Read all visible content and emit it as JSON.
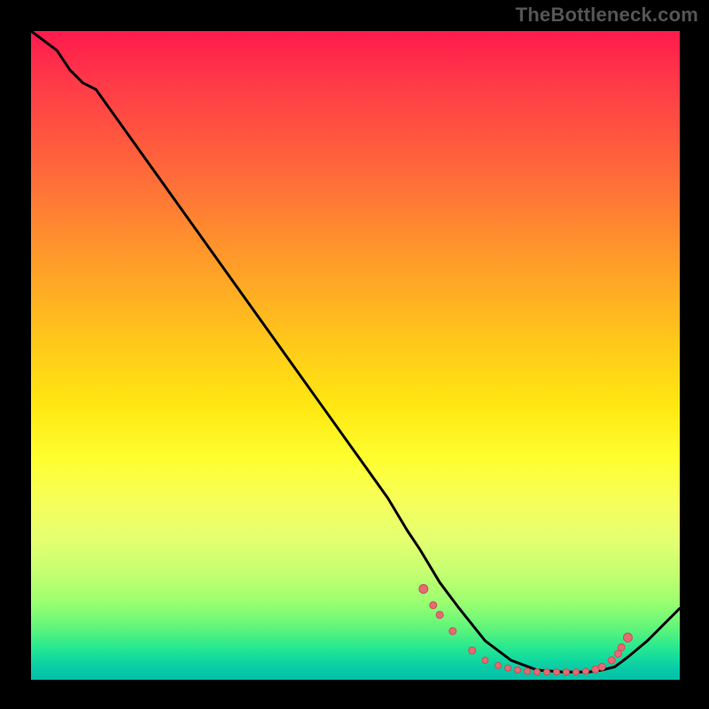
{
  "watermark": "TheBottleneck.com",
  "chart_data": {
    "type": "line",
    "title": "",
    "xlabel": "",
    "ylabel": "",
    "xlim": [
      0,
      100
    ],
    "ylim": [
      0,
      100
    ],
    "grid": false,
    "curve_x": [
      0,
      4,
      6,
      8,
      10,
      15,
      20,
      25,
      30,
      35,
      40,
      45,
      50,
      55,
      58,
      60,
      63,
      66,
      70,
      74,
      78,
      82,
      86,
      88,
      90,
      92,
      95,
      98,
      100
    ],
    "curve_y": [
      100,
      97,
      94,
      92,
      91,
      84,
      77,
      70,
      63,
      56,
      49,
      42,
      35,
      28,
      23,
      20,
      15,
      11,
      6,
      3,
      1.5,
      1.2,
      1.2,
      1.5,
      2,
      3.5,
      6,
      9,
      11
    ],
    "markers": [
      {
        "x": 60.5,
        "y": 14.0,
        "r": 5
      },
      {
        "x": 62.0,
        "y": 11.5,
        "r": 4
      },
      {
        "x": 63.0,
        "y": 10.0,
        "r": 4
      },
      {
        "x": 65.0,
        "y": 7.5,
        "r": 4
      },
      {
        "x": 68.0,
        "y": 4.5,
        "r": 4
      },
      {
        "x": 70.0,
        "y": 3.0,
        "r": 3.5
      },
      {
        "x": 72.0,
        "y": 2.2,
        "r": 3.5
      },
      {
        "x": 73.5,
        "y": 1.8,
        "r": 3.5
      },
      {
        "x": 75.0,
        "y": 1.5,
        "r": 3.5
      },
      {
        "x": 76.5,
        "y": 1.3,
        "r": 3.5
      },
      {
        "x": 78.0,
        "y": 1.2,
        "r": 3.5
      },
      {
        "x": 79.5,
        "y": 1.2,
        "r": 3.5
      },
      {
        "x": 81.0,
        "y": 1.2,
        "r": 3.5
      },
      {
        "x": 82.5,
        "y": 1.2,
        "r": 3.5
      },
      {
        "x": 84.0,
        "y": 1.2,
        "r": 3.5
      },
      {
        "x": 85.5,
        "y": 1.3,
        "r": 3.5
      },
      {
        "x": 87.0,
        "y": 1.6,
        "r": 4
      },
      {
        "x": 88.0,
        "y": 2.0,
        "r": 4
      },
      {
        "x": 89.5,
        "y": 3.0,
        "r": 4
      },
      {
        "x": 90.5,
        "y": 4.0,
        "r": 4
      },
      {
        "x": 91.0,
        "y": 5.0,
        "r": 4
      },
      {
        "x": 92.0,
        "y": 6.5,
        "r": 5
      }
    ],
    "colors": {
      "line": "#000000",
      "marker_fill": "#e46b72",
      "marker_stroke": "#c94f57"
    }
  }
}
